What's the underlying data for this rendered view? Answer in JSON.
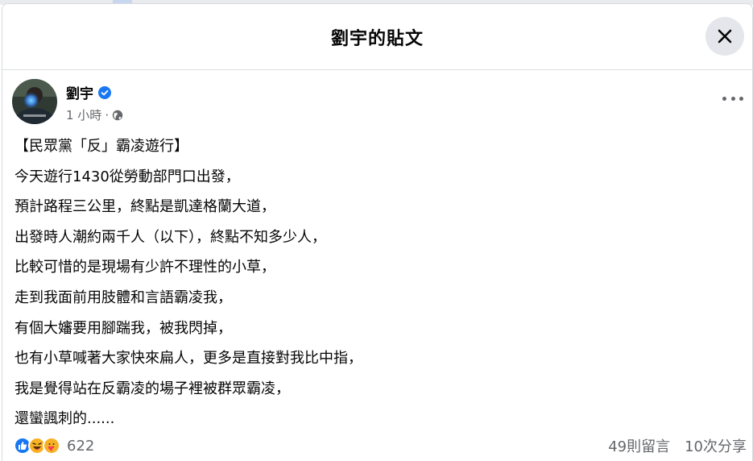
{
  "modal": {
    "title": "劉宇的貼文",
    "close_icon": "close-icon"
  },
  "post": {
    "author": "劉宇",
    "verified": true,
    "time": "1 小時",
    "separator": "·",
    "audience_icon": "globe-icon",
    "more_icon": "more-horizontal-icon",
    "lines": [
      "【民眾黨「反」霸凌遊行】",
      "今天遊行1430從勞動部門口出發，",
      "預計路程三公里，終點是凱達格蘭大道，",
      "出發時人潮約兩千人（以下），終點不知多少人，",
      "比較可惜的是現場有少許不理性的小草，",
      "走到我面前用肢體和言語霸凌我，",
      "有個大嬸要用腳踹我，被我閃掉，",
      "也有小草喊著大家快來扁人，更多是直接對我比中指，",
      "我是覺得站在反霸凌的場子裡被群眾霸凌，",
      "還蠻諷刺的......"
    ]
  },
  "footer": {
    "reaction_icons": [
      "like-icon",
      "laugh-icon",
      "care-icon"
    ],
    "reaction_count": "622",
    "comments": "49則留言",
    "shares": "10次分享"
  },
  "colors": {
    "secondary_text": "#65676b",
    "verified_blue": "#1877f2",
    "close_bg": "#e4e6eb"
  }
}
